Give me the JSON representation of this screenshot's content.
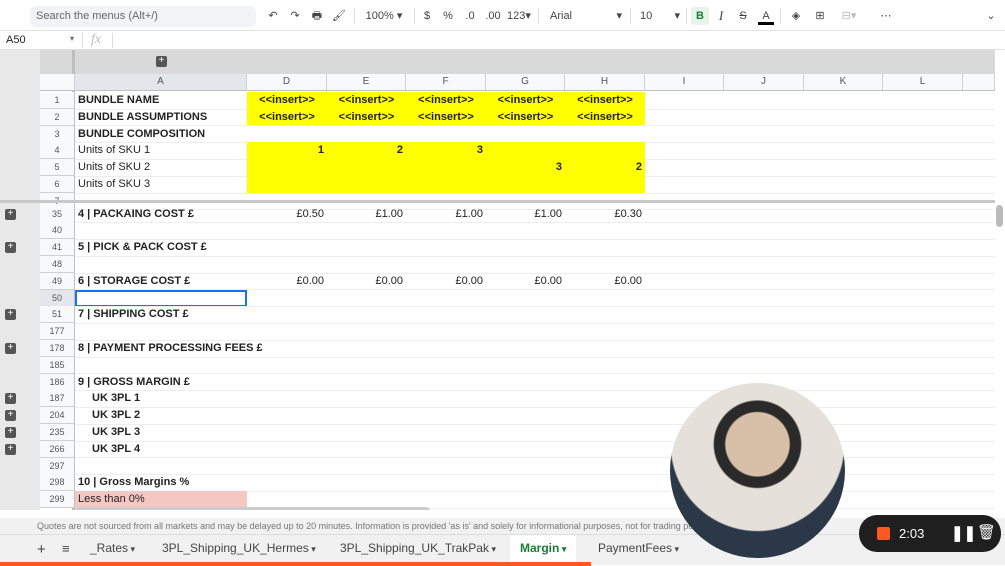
{
  "toolbar": {
    "search_placeholder": "Search the menus (Alt+/)",
    "zoom": "100%",
    "currency": "$",
    "percent": "%",
    "dec_less": ".0",
    "dec_more": ".00",
    "number_format": "123",
    "font": "Arial",
    "font_size": "10",
    "bold": "B",
    "italic": "I",
    "strike": "S",
    "text_color": "A",
    "more": "⋯"
  },
  "formula_bar": {
    "name_box": "A50",
    "fx": "fx",
    "value": ""
  },
  "columns": [
    "A",
    "D",
    "E",
    "F",
    "G",
    "H",
    "I",
    "J",
    "K",
    "L"
  ],
  "rows": [
    {
      "n": "1",
      "label": "BUNDLE NAME",
      "bold": true,
      "vals": [
        "<<insert>>",
        "<<insert>>",
        "<<insert>>",
        "<<insert>>",
        "<<insert>>"
      ],
      "yellow": true,
      "center": true
    },
    {
      "n": "2",
      "label": "BUNDLE ASSUMPTIONS",
      "bold": true,
      "vals": [
        "<<insert>>",
        "<<insert>>",
        "<<insert>>",
        "<<insert>>",
        "<<insert>>"
      ],
      "yellow": true,
      "center": true
    },
    {
      "n": "3",
      "label": "BUNDLE COMPOSITION",
      "bold": true,
      "vals": [
        "",
        "",
        "",
        "",
        ""
      ]
    },
    {
      "n": "4",
      "label": "Units of SKU 1",
      "vals": [
        "1",
        "2",
        "3",
        "",
        ""
      ],
      "yellow": true,
      "boldvals": true
    },
    {
      "n": "5",
      "label": "Units of SKU 2",
      "vals": [
        "",
        "",
        "",
        "3",
        "2"
      ],
      "yellow": true,
      "boldvals": true
    },
    {
      "n": "6",
      "label": "Units of SKU 3",
      "vals": [
        "",
        "",
        "",
        "",
        ""
      ],
      "yellow": true
    },
    {
      "n": "7",
      "label": "",
      "vals": [
        "",
        "",
        "",
        "",
        ""
      ]
    },
    {
      "n": "35",
      "label": "4 | PACKAING COST £",
      "bold": true,
      "vals": [
        "£0.50",
        "£1.00",
        "£1.00",
        "£1.00",
        "£0.30"
      ],
      "plus": true
    },
    {
      "n": "40",
      "label": "",
      "vals": [
        "",
        "",
        "",
        "",
        ""
      ]
    },
    {
      "n": "41",
      "label": "5 | PICK & PACK COST £",
      "bold": true,
      "vals": [
        "",
        "",
        "",
        "",
        ""
      ],
      "plus": true
    },
    {
      "n": "48",
      "label": "",
      "vals": [
        "",
        "",
        "",
        "",
        ""
      ]
    },
    {
      "n": "49",
      "label": "6 | STORAGE COST £",
      "bold": true,
      "vals": [
        "£0.00",
        "£0.00",
        "£0.00",
        "£0.00",
        "£0.00"
      ]
    },
    {
      "n": "50",
      "label": "",
      "vals": [
        "",
        "",
        "",
        "",
        ""
      ],
      "selected": true
    },
    {
      "n": "51",
      "label": "7 | SHIPPING COST £",
      "bold": true,
      "vals": [
        "",
        "",
        "",
        "",
        ""
      ],
      "plus": true
    },
    {
      "n": "177",
      "label": "",
      "vals": [
        "",
        "",
        "",
        "",
        ""
      ]
    },
    {
      "n": "178",
      "label": "8 | PAYMENT PROCESSING FEES £",
      "bold": true,
      "vals": [
        "",
        "",
        "",
        "",
        ""
      ],
      "plus": true
    },
    {
      "n": "185",
      "label": "",
      "vals": [
        "",
        "",
        "",
        "",
        ""
      ]
    },
    {
      "n": "186",
      "label": "9 | GROSS MARGIN £",
      "bold": true,
      "vals": [
        "",
        "",
        "",
        "",
        ""
      ]
    },
    {
      "n": "187",
      "label": "UK 3PL 1",
      "bold": true,
      "indent": true,
      "vals": [
        "",
        "",
        "",
        "",
        ""
      ],
      "plus": true
    },
    {
      "n": "204",
      "label": "UK 3PL 2",
      "bold": true,
      "indent": true,
      "vals": [
        "",
        "",
        "",
        "",
        ""
      ],
      "plus": true
    },
    {
      "n": "235",
      "label": "UK 3PL 3",
      "bold": true,
      "indent": true,
      "vals": [
        "",
        "",
        "",
        "",
        ""
      ],
      "plus": true
    },
    {
      "n": "266",
      "label": "UK 3PL 4",
      "bold": true,
      "indent": true,
      "vals": [
        "",
        "",
        "",
        "",
        ""
      ],
      "plus": true
    },
    {
      "n": "297",
      "label": "",
      "vals": [
        "",
        "",
        "",
        "",
        ""
      ]
    },
    {
      "n": "298",
      "label": "10 | Gross Margins %",
      "bold": true,
      "vals": [
        "",
        "",
        "",
        "",
        ""
      ]
    },
    {
      "n": "299",
      "label": "Less than 0%",
      "pink": true,
      "vals": [
        "",
        "",
        "",
        "",
        ""
      ]
    }
  ],
  "disclaimer": "Quotes are not sourced from all markets and may be delayed up to 20 minutes. Information is provided 'as is' and solely for informational purposes, not for trading purposes or advice.",
  "sheet_tabs": [
    {
      "label": "_Rates"
    },
    {
      "label": "3PL_Shipping_UK_Hermes"
    },
    {
      "label": "3PL_Shipping_UK_TrakPak"
    },
    {
      "label": "Margin",
      "active": true
    },
    {
      "label": "PaymentFees"
    }
  ],
  "recorder": {
    "time": "2:03"
  },
  "colors": {
    "yellow": "#ffff00",
    "pink": "#f4c7c3",
    "active_tab": "#188038",
    "record": "#ff5722"
  }
}
